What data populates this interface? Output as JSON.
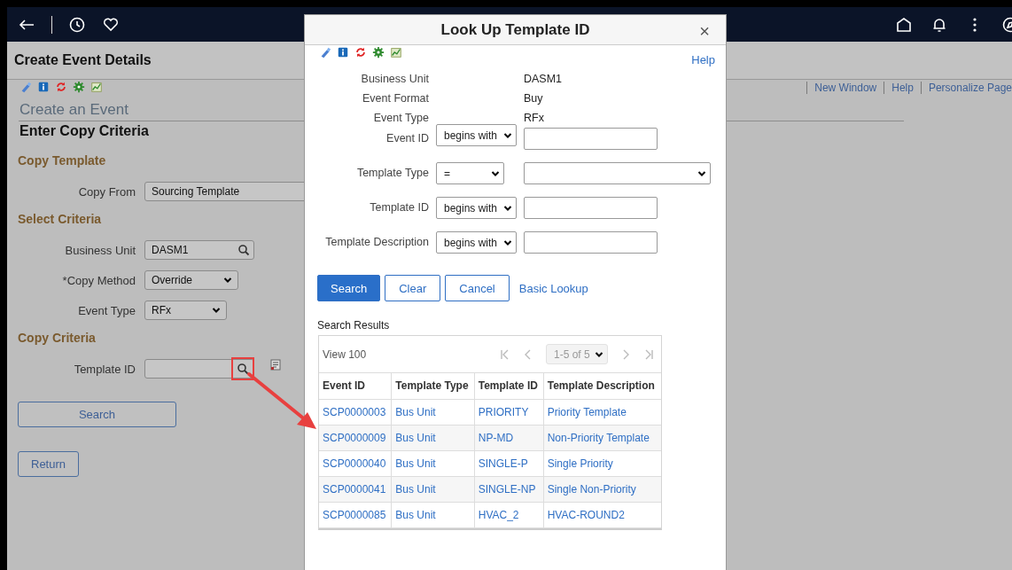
{
  "page": {
    "title": "Create Event Details",
    "links": [
      "New Window",
      "Help",
      "Personalize Page"
    ],
    "heading": "Create an Event",
    "subheading": "Enter Copy Criteria",
    "sections": [
      {
        "title": "Copy Template",
        "fields": [
          {
            "label": "Copy From",
            "kind": "wide",
            "value": "Sourcing Template"
          }
        ]
      },
      {
        "title": "Select Criteria",
        "fields": [
          {
            "label": "Business Unit",
            "kind": "lookup",
            "value": "DASM1",
            "highlighted": false
          },
          {
            "label": "*Copy Method",
            "kind": "select",
            "value": "Override"
          },
          {
            "label": "Event Type",
            "kind": "select-short",
            "value": "RFx"
          }
        ]
      },
      {
        "title": "Copy Criteria",
        "fields": [
          {
            "label": "Template ID",
            "kind": "lookup-list",
            "highlighted": true
          }
        ]
      }
    ],
    "buttons": [
      {
        "label": "Search",
        "kind": "wide"
      },
      {
        "label": "Return",
        "kind": "normal"
      }
    ]
  },
  "dialog": {
    "title": "Look Up Template ID",
    "close": "×",
    "help": "Help",
    "info": [
      {
        "label": "Business Unit",
        "value": "DASM1"
      },
      {
        "label": "Event Format",
        "value": "Buy"
      },
      {
        "label": "Event Type",
        "value": "RFx"
      }
    ],
    "criteria": [
      {
        "label": "Event ID",
        "operator": "begins with",
        "kind": "text"
      },
      {
        "label": "Template Type",
        "operator": "=",
        "kind": "select"
      },
      {
        "label": "Template ID",
        "operator": "begins with",
        "kind": "text"
      },
      {
        "label": "Template Description",
        "operator": "begins with",
        "kind": "text"
      }
    ],
    "buttons": [
      {
        "label": "Search",
        "kind": "primary"
      },
      {
        "label": "Clear",
        "kind": "secondary"
      },
      {
        "label": "Cancel",
        "kind": "secondary"
      },
      {
        "label": "Basic Lookup",
        "kind": "link"
      }
    ],
    "results": {
      "title": "Search Results",
      "view": "View 100",
      "pager": "1-5 of 5",
      "columns": [
        "Event ID",
        "Template Type",
        "Template ID",
        "Template Description"
      ],
      "rows": [
        [
          "SCP0000003",
          "Bus Unit",
          "PRIORITY",
          "Priority Template"
        ],
        [
          "SCP0000009",
          "Bus Unit",
          "NP-MD",
          "Non-Priority Template"
        ],
        [
          "SCP0000040",
          "Bus Unit",
          "SINGLE-P",
          "Single Priority"
        ],
        [
          "SCP0000041",
          "Bus Unit",
          "SINGLE-NP",
          "Single Non-Priority"
        ],
        [
          "SCP0000085",
          "Bus Unit",
          "HVAC_2",
          "HVAC-ROUND2"
        ]
      ]
    }
  }
}
